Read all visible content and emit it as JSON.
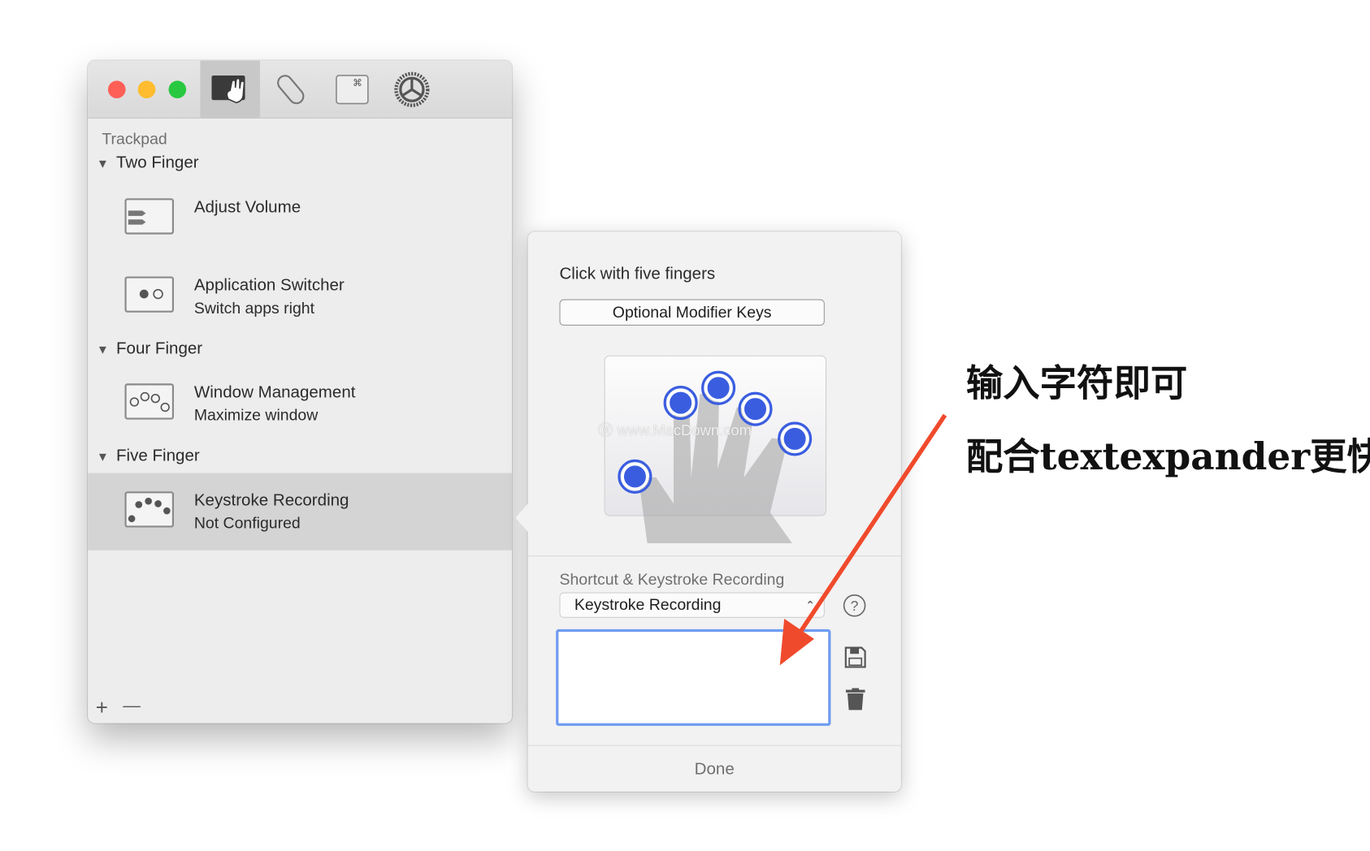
{
  "toolbar": {
    "tabs": [
      {
        "icon": "trackpad-gesture-icon",
        "selected": true
      },
      {
        "icon": "magic-mouse-icon",
        "selected": false
      },
      {
        "icon": "keyboard-command-icon",
        "selected": false
      },
      {
        "icon": "settings-gear-icon",
        "selected": false
      }
    ]
  },
  "sidebar": {
    "device": "Trackpad",
    "groups": [
      {
        "label": "Two Finger",
        "items": [
          {
            "title": "Adjust Volume",
            "subtitle": ""
          },
          {
            "title": "Application Switcher",
            "subtitle": "Switch apps right"
          }
        ]
      },
      {
        "label": "Four Finger",
        "items": [
          {
            "title": "Window Management",
            "subtitle": "Maximize window"
          }
        ]
      },
      {
        "label": "Five Finger",
        "items": [
          {
            "title": "Keystroke Recording",
            "subtitle": "Not Configured",
            "selected": true
          }
        ]
      }
    ],
    "add_label": "+",
    "remove_label": "—"
  },
  "popover": {
    "title": "Click with five fingers",
    "modifier_button": "Optional Modifier Keys",
    "watermark": "www.MacDown.com",
    "section_label": "Shortcut & Keystroke Recording",
    "select_value": "Keystroke Recording",
    "keystroke_text": "",
    "done_label": "Done"
  },
  "annotation": {
    "line1": "输入字符即可",
    "line2": "配合textexpander更快",
    "arrow_color": "#f04a2c"
  },
  "colors": {
    "accent": "#3a5de0",
    "focus": "#6e9cf0",
    "close": "#fe5f57",
    "minimize": "#febc2e",
    "zoom": "#28c840"
  }
}
